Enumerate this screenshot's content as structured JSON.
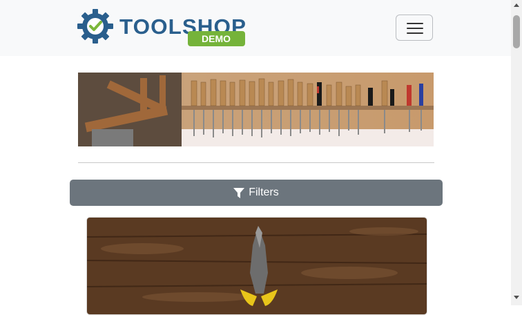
{
  "header": {
    "logo_text_primary": "TOOLSHOP",
    "logo_badge_text": "DEMO",
    "logo_colors": {
      "gear": "#2a5f8d",
      "check": "#7cb83b",
      "badge": "#75b33a"
    },
    "menu_toggle_icon": "hamburger-icon"
  },
  "main": {
    "filters_button": {
      "label": "Filters",
      "icon": "filter-icon",
      "color": "#6c757d"
    }
  },
  "colors": {
    "navbar_bg": "#f8f9fa",
    "page_bg": "#ffffff"
  }
}
